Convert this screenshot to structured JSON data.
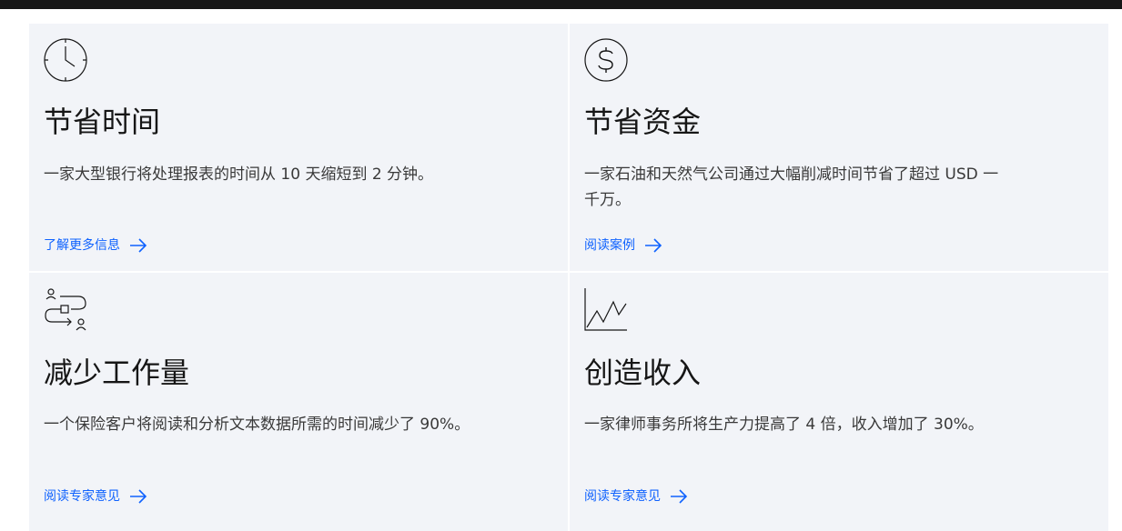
{
  "cards": [
    {
      "icon": "clock-icon",
      "title": "节省时间",
      "description": "一家大型银行将处理报表的时间从 10 天缩短到 2 分钟。",
      "link": "了解更多信息"
    },
    {
      "icon": "dollar-icon",
      "title": "节省资金",
      "description": "一家石油和天然气公司通过大幅削减时间节省了超过 USD 一千万。",
      "link": "阅读案例"
    },
    {
      "icon": "workflow-icon",
      "title": "减少工作量",
      "description": "一个保险客户将阅读和分析文本数据所需的时间减少了 90%。",
      "link": "阅读专家意见"
    },
    {
      "icon": "line-chart-icon",
      "title": "创造收入",
      "description": "一家律师事务所将生产力提高了 4 倍，收入增加了 30%。",
      "link": "阅读专家意见"
    }
  ],
  "colors": {
    "top_bar": "#161616",
    "card_bg": "#f2f4f8",
    "link": "#0f62fe",
    "title": "#161616",
    "text": "#393939"
  }
}
